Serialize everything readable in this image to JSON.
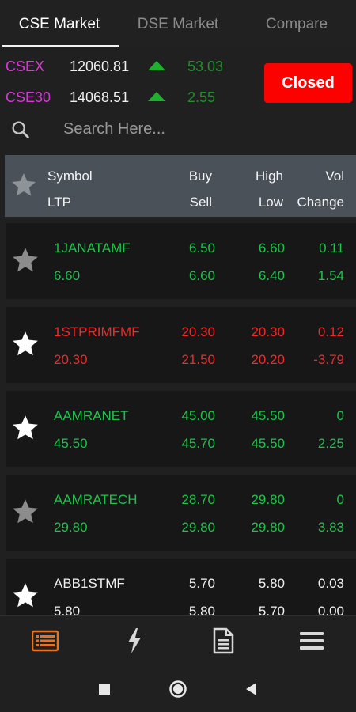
{
  "tabs": [
    {
      "label": "CSE Market"
    },
    {
      "label": "DSE Market"
    },
    {
      "label": "Compare"
    }
  ],
  "indices": [
    {
      "name": "CSEX",
      "value": "12060.81",
      "change": "53.03",
      "direction": "up"
    },
    {
      "name": "CSE30",
      "value": "14068.51",
      "change": "2.55",
      "direction": "up"
    }
  ],
  "market_status": "Closed",
  "search": {
    "placeholder": "Search Here..."
  },
  "header": {
    "symbol": "Symbol",
    "ltp": "LTP",
    "buy": "Buy",
    "sell": "Sell",
    "high": "High",
    "low": "Low",
    "vol": "Vol",
    "change": "Change"
  },
  "stocks": [
    {
      "symbol": "1JANATAMF",
      "ltp": "6.60",
      "buy": "6.50",
      "sell": "6.60",
      "high": "6.60",
      "low": "6.40",
      "vol": "0.11",
      "change": "1.54",
      "trend": "up",
      "favorite": false
    },
    {
      "symbol": "1STPRIMFMF",
      "ltp": "20.30",
      "buy": "20.30",
      "sell": "21.50",
      "high": "20.30",
      "low": "20.20",
      "vol": "0.12",
      "change": "-3.79",
      "trend": "down",
      "favorite": true
    },
    {
      "symbol": "AAMRANET",
      "ltp": "45.50",
      "buy": "45.00",
      "sell": "45.70",
      "high": "45.50",
      "low": "45.50",
      "vol": "0",
      "change": "2.25",
      "trend": "up",
      "favorite": true
    },
    {
      "symbol": "AAMRATECH",
      "ltp": "29.80",
      "buy": "28.70",
      "sell": "29.80",
      "high": "29.80",
      "low": "29.80",
      "vol": "0",
      "change": "3.83",
      "trend": "up",
      "favorite": false
    },
    {
      "symbol": "ABB1STMF",
      "ltp": "5.80",
      "buy": "5.70",
      "sell": "5.80",
      "high": "5.80",
      "low": "5.70",
      "vol": "0.03",
      "change": "0.00",
      "trend": "neutral",
      "favorite": true
    }
  ],
  "bottom_nav": [
    {
      "icon": "list-icon",
      "active": true
    },
    {
      "icon": "lightning-icon",
      "active": false
    },
    {
      "icon": "document-icon",
      "active": false
    },
    {
      "icon": "menu-icon",
      "active": false
    }
  ],
  "colors": {
    "up": "#1fc24b",
    "down": "#ee2a2a",
    "neutral": "#f0f0f0",
    "accent": "#e8731e",
    "closed": "#fb0100",
    "index_name": "#d63ad6"
  }
}
